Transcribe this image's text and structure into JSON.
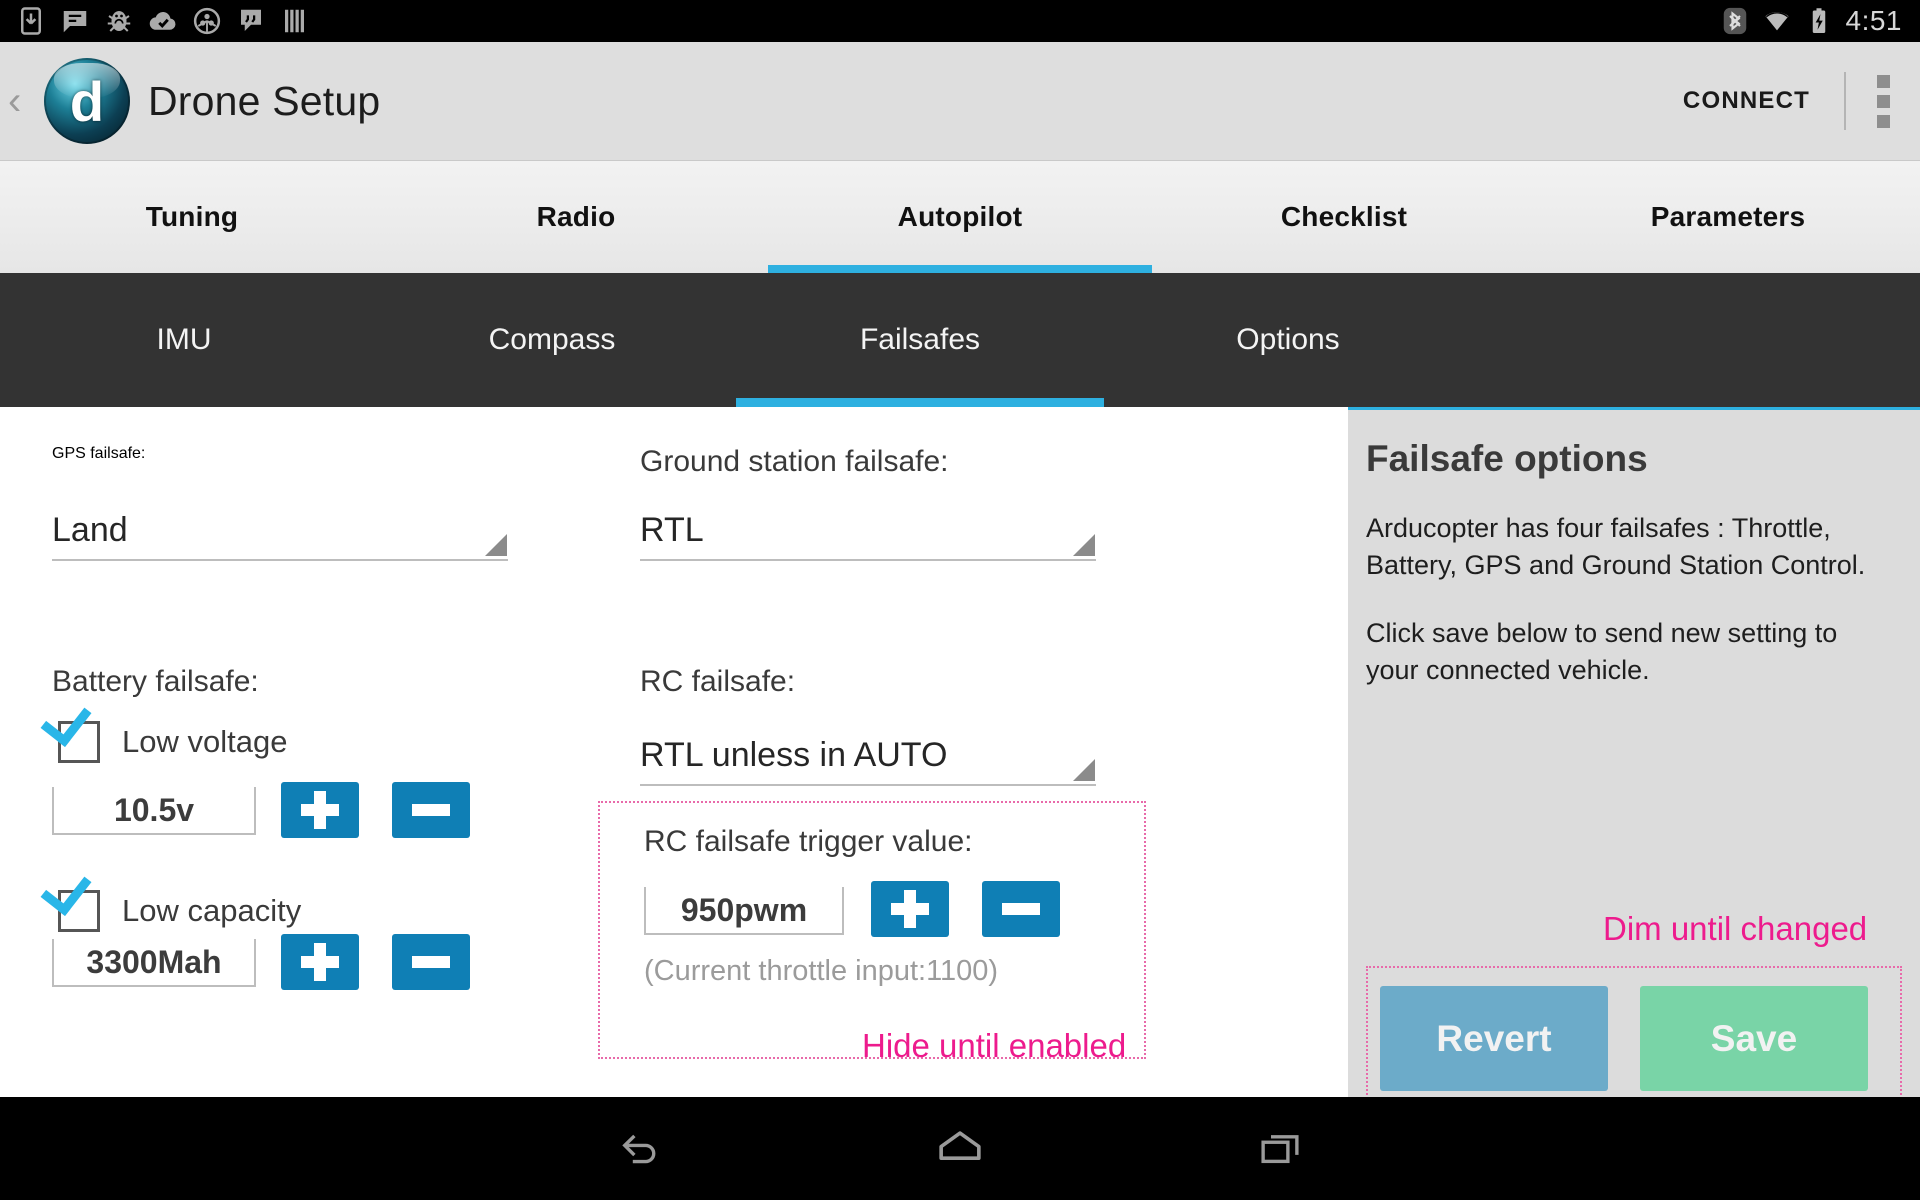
{
  "statusbar": {
    "clock": "4:51",
    "left_icons": [
      "download-to-device-icon",
      "sms-message-icon",
      "debug-bug-icon",
      "cloud-check-icon",
      "moto-circle-icon",
      "hangouts-icon",
      "barcode-icon"
    ],
    "right_icons": [
      "bluetooth-icon",
      "wifi-icon",
      "battery-charging-icon"
    ]
  },
  "actionbar": {
    "back_glyph": "‹",
    "logo_glyph": "d",
    "title": "Drone Setup",
    "connect_label": "CONNECT",
    "overflow_icon": "overflow-menu-icon"
  },
  "tabs": [
    {
      "label": "Tuning",
      "active": false
    },
    {
      "label": "Radio",
      "active": false
    },
    {
      "label": "Autopilot",
      "active": true
    },
    {
      "label": "Checklist",
      "active": false
    },
    {
      "label": "Parameters",
      "active": false
    }
  ],
  "subtabs": [
    {
      "label": "IMU",
      "active": false
    },
    {
      "label": "Compass",
      "active": false
    },
    {
      "label": "Failsafes",
      "active": true
    },
    {
      "label": "Options",
      "active": false
    }
  ],
  "form": {
    "gps_failsafe": {
      "label": "GPS failsafe:",
      "value": "Land"
    },
    "ground_station_failsafe": {
      "label": "Ground station failsafe:",
      "value": "RTL"
    },
    "battery_failsafe": {
      "label": "Battery failsafe:",
      "low_voltage": {
        "label": "Low voltage",
        "checked": true,
        "value": "10.5v"
      },
      "low_capacity": {
        "label": "Low capacity",
        "checked": true,
        "value": "3300Mah"
      }
    },
    "rc_failsafe": {
      "label": "RC failsafe:",
      "value": "RTL unless in AUTO"
    },
    "rc_trigger": {
      "label": "RC failsafe trigger value:",
      "value": "950pwm",
      "hint": "(Current throttle input:1100)",
      "annotation": "Hide until enabled"
    },
    "plus_label": "+",
    "minus_label": "−"
  },
  "sidepanel": {
    "title": "Failsafe options",
    "paragraph1": "Arducopter has four failsafes : Throttle, Battery, GPS and Ground Station Control.",
    "paragraph2": "Click save below to send new setting to your connected vehicle.",
    "annotation": "Dim until changed",
    "revert_label": "Revert",
    "save_label": "Save",
    "revert_color": "#6cabc9",
    "save_color": "#79d4a7"
  },
  "navbar": {
    "back": "back-nav-icon",
    "home": "home-nav-icon",
    "recents": "recents-nav-icon"
  },
  "colors": {
    "accent": "#2eb0e0",
    "subtab_bg": "#333333",
    "stepper_blue": "#0f7fb5",
    "annotation_pink": "#ed1b8d",
    "dotted_pink": "#e86aaa"
  }
}
